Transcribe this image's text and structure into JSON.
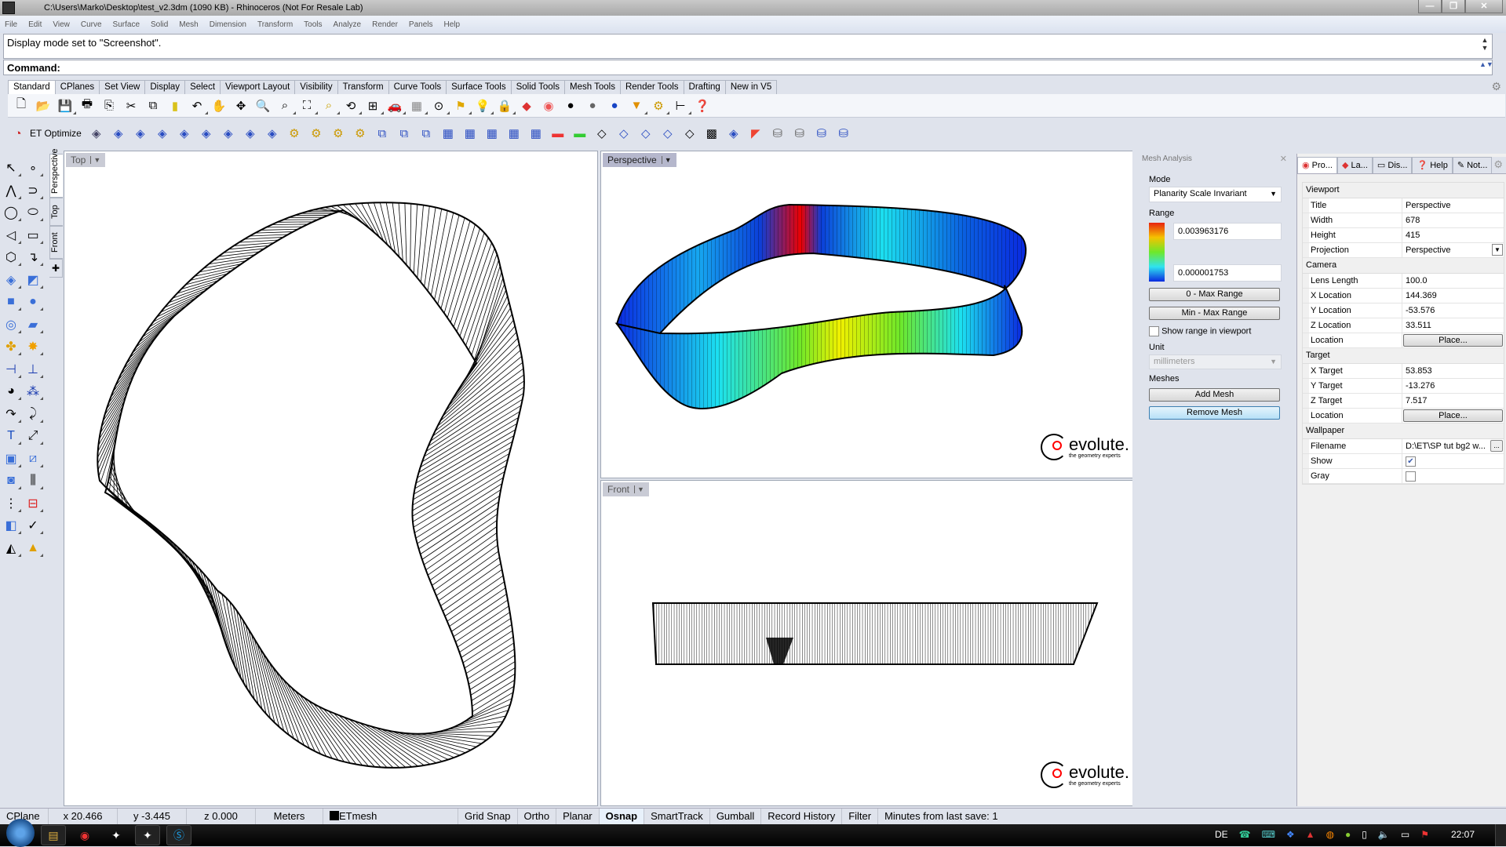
{
  "window": {
    "title": "C:\\Users\\Marko\\Desktop\\test_v2.3dm (1090 KB) - Rhinoceros (Not For Resale Lab)",
    "controls": [
      "minimize",
      "maximize",
      "close"
    ]
  },
  "menu": [
    "File",
    "Edit",
    "View",
    "Curve",
    "Surface",
    "Solid",
    "Mesh",
    "Dimension",
    "Transform",
    "Tools",
    "Analyze",
    "Render",
    "Panels",
    "Help"
  ],
  "command": {
    "history": "Display mode set to \"Screenshot\".",
    "prompt": "Command:"
  },
  "toolbar_tabs": [
    "Standard",
    "CPlanes",
    "Set View",
    "Display",
    "Select",
    "Viewport Layout",
    "Visibility",
    "Transform",
    "Curve Tools",
    "Surface Tools",
    "Solid Tools",
    "Mesh Tools",
    "Render Tools",
    "Drafting",
    "New in V5"
  ],
  "active_toolbar_tab": "Standard",
  "standard_tools": [
    "new-icon",
    "open-icon",
    "save-icon",
    "print-icon",
    "import-icon",
    "cut-icon",
    "copy-icon",
    "paste-icon",
    "undo-icon",
    "pan-icon",
    "rotate-view-icon",
    "zoom-icon",
    "zoom-window-icon",
    "zoom-extents-icon",
    "zoom-selected-icon",
    "undo-view-icon",
    "viewport-layout-icon",
    "car-icon",
    "grid-icon",
    "cplane-icon",
    "snap-icon",
    "light-icon",
    "lock-icon",
    "layer-icon",
    "color-wheel-icon",
    "wireframe-sphere-icon",
    "shaded-sphere-icon",
    "rendered-sphere-icon",
    "material-icon",
    "options-gear-icon",
    "dimension-icon",
    "help-icon"
  ],
  "et_toolbar": {
    "label": "ET Optimize",
    "tools": [
      "et-mesh-1",
      "et-mesh-2",
      "et-mesh-3",
      "et-mesh-4",
      "et-mesh-5",
      "et-mesh-6",
      "et-mesh-7",
      "et-mesh-8",
      "et-mesh-9",
      "et-gear-1",
      "et-gear-2",
      "et-gear-3",
      "et-gear-4",
      "et-copy-1",
      "et-bulb",
      "et-cut",
      "et-grid-1",
      "et-grid-2",
      "et-grid-3",
      "et-grid-4",
      "et-grid-5",
      "et-gradient-1",
      "et-gradient-2",
      "et-select-1",
      "et-select-2",
      "et-select-3",
      "et-select-4",
      "et-checker",
      "et-mesh-10",
      "et-paint",
      "et-bucket-1",
      "et-bucket-2",
      "et-bucket-3",
      "et-bucket-4"
    ]
  },
  "left_tools": [
    [
      "select-icon",
      "point-icon"
    ],
    [
      "polyline-icon",
      "curve-icon"
    ],
    [
      "circle-icon",
      "ellipse-icon"
    ],
    [
      "arc-icon",
      "rectangle-icon"
    ],
    [
      "polygon-icon",
      "fillet-curve-icon"
    ],
    [
      "surface-points-icon",
      "surface-edge-icon"
    ],
    [
      "box-icon",
      "sphere-union-icon"
    ],
    [
      "cylinder-icon",
      "surface-loft-icon"
    ],
    [
      "join-icon",
      "explode-icon"
    ],
    [
      "trim-icon",
      "split-icon"
    ],
    [
      "boolean-icon",
      "group-icon"
    ],
    [
      "offset-icon",
      "blend-icon"
    ],
    [
      "text-icon",
      "scale-icon"
    ],
    [
      "array-icon",
      "orient-icon"
    ],
    [
      "solid-edit-icon",
      "dimension-icon"
    ],
    [
      "grid-array-icon",
      "analyze-icon"
    ],
    [
      "mirror-icon",
      "check-icon"
    ],
    [
      "render-shapes-icon",
      "light-pyramid-icon"
    ]
  ],
  "viewport_tabs": [
    "Perspective",
    "Top",
    "Front"
  ],
  "viewports": {
    "top": {
      "title": "Top"
    },
    "perspective": {
      "title": "Perspective"
    },
    "front": {
      "title": "Front"
    }
  },
  "watermark": {
    "brand": "evolute.",
    "tagline": "the geometry experts"
  },
  "mesh_analysis": {
    "title": "Mesh Analysis",
    "mode_label": "Mode",
    "mode_value": "Planarity Scale Invariant",
    "range_label": "Range",
    "range_max": "0.003963176",
    "range_min": "0.000001753",
    "btn_zero_max": "0 - Max Range",
    "btn_min_max": "Min - Max Range",
    "show_range_label": "Show range in viewport",
    "show_range_checked": false,
    "unit_label": "Unit",
    "unit_value": "millimeters",
    "meshes_label": "Meshes",
    "btn_add": "Add Mesh",
    "btn_remove": "Remove Mesh",
    "colors": {
      "max": "#e8230f",
      "mid": "#6ee82a",
      "min": "#0a2ae0"
    }
  },
  "properties": {
    "tabs": [
      "Pro...",
      "La...",
      "Dis...",
      "Help",
      "Not..."
    ],
    "groups": {
      "viewport": "Viewport",
      "camera": "Camera",
      "target": "Target",
      "wallpaper": "Wallpaper"
    },
    "viewport_rows": [
      {
        "key": "Title",
        "value": "Perspective"
      },
      {
        "key": "Width",
        "value": "678"
      },
      {
        "key": "Height",
        "value": "415"
      },
      {
        "key": "Projection",
        "value": "Perspective"
      }
    ],
    "camera_rows": [
      {
        "key": "Lens Length",
        "value": "100.0"
      },
      {
        "key": "X Location",
        "value": "144.369"
      },
      {
        "key": "Y Location",
        "value": "-53.576"
      },
      {
        "key": "Z Location",
        "value": "33.511"
      },
      {
        "key": "Location",
        "value": "Place..."
      }
    ],
    "target_rows": [
      {
        "key": "X Target",
        "value": "53.853"
      },
      {
        "key": "Y Target",
        "value": "-13.276"
      },
      {
        "key": "Z Target",
        "value": "7.517"
      },
      {
        "key": "Location",
        "value": "Place..."
      }
    ],
    "wallpaper_rows": [
      {
        "key": "Filename",
        "value": "D:\\ET\\SP tut bg2 w..."
      },
      {
        "key": "Show",
        "checked": true
      },
      {
        "key": "Gray",
        "checked": false
      }
    ]
  },
  "status": {
    "cplane": "CPlane",
    "x": "x 20.466",
    "y": "y -3.445",
    "z": "z 0.000",
    "units": "Meters",
    "layer": "ETmesh",
    "toggles": [
      "Grid Snap",
      "Ortho",
      "Planar",
      "Osnap",
      "SmartTrack",
      "Gumball",
      "Record History",
      "Filter"
    ],
    "active_toggle": "Osnap",
    "save_info": "Minutes from last save: 1"
  },
  "taskbar": {
    "apps": [
      "explorer",
      "chrome",
      "rhino-launcher",
      "rhinoceros",
      "skype"
    ],
    "language": "DE",
    "clock": "22:07"
  }
}
